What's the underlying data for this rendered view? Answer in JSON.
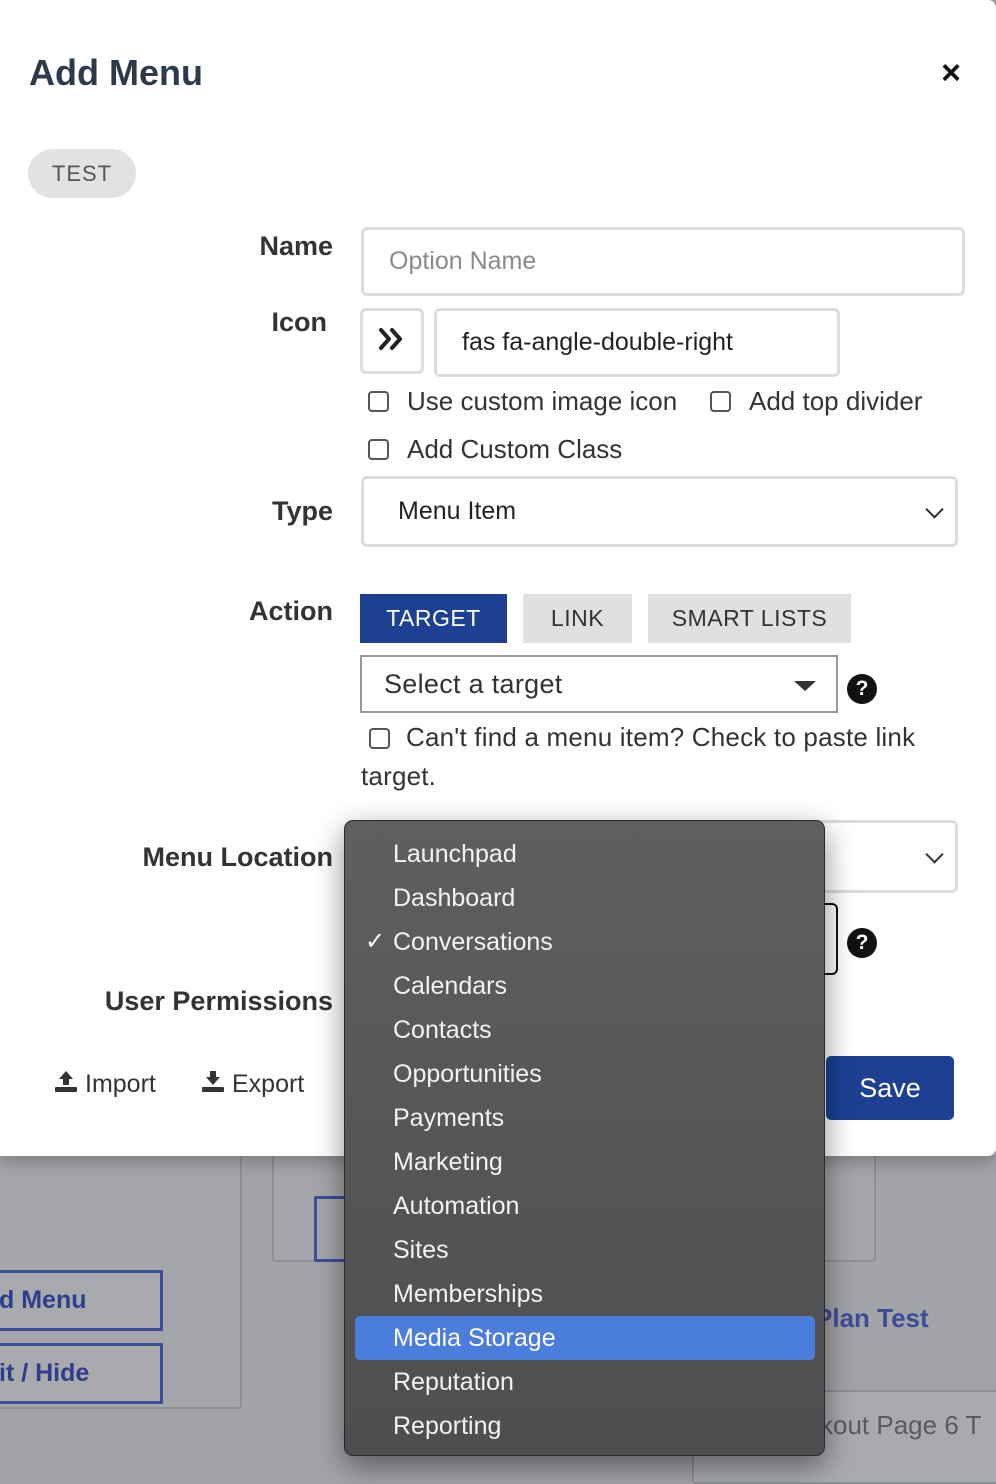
{
  "background": {
    "btn_add_menu": "d Menu",
    "btn_edit_hide": "it / Hide",
    "plan_test": "Plan Test",
    "checkout_page": "kout Page 6 T"
  },
  "modal": {
    "title": "Add Menu",
    "close_icon": "×",
    "tag_pill": "TEST",
    "name_label": "Name",
    "name_placeholder": "Option Name",
    "icon_label": "Icon",
    "icon_glyph": "»",
    "icon_value": "fas fa-angle-double-right",
    "cb_custom_image": "Use custom image icon",
    "cb_top_divider": "Add top divider",
    "cb_custom_class": "Add Custom Class",
    "type_label": "Type",
    "type_value": "Menu Item",
    "action_label": "Action",
    "tabs": [
      "TARGET",
      "LINK",
      "SMART LISTS"
    ],
    "target_placeholder": "Select a target",
    "help_glyph": "?",
    "paste_link_text": "Can't find a menu item? Check to paste link target.",
    "menu_location_label": "Menu Location",
    "user_permissions_label": "User Permissions",
    "import_label": "Import",
    "export_label": "Export",
    "save_label": "Save"
  },
  "dropdown": {
    "items": [
      "Launchpad",
      "Dashboard",
      "Conversations",
      "Calendars",
      "Contacts",
      "Opportunities",
      "Payments",
      "Marketing",
      "Automation",
      "Sites",
      "Memberships",
      "Media Storage",
      "Reputation",
      "Reporting"
    ],
    "checked_item": "Conversations",
    "highlighted_item": "Media Storage",
    "check_glyph": "✓"
  },
  "colors": {
    "primary": "#1d4092",
    "highlight": "#4a7ddc",
    "dropdown_bg": "#58585a"
  }
}
